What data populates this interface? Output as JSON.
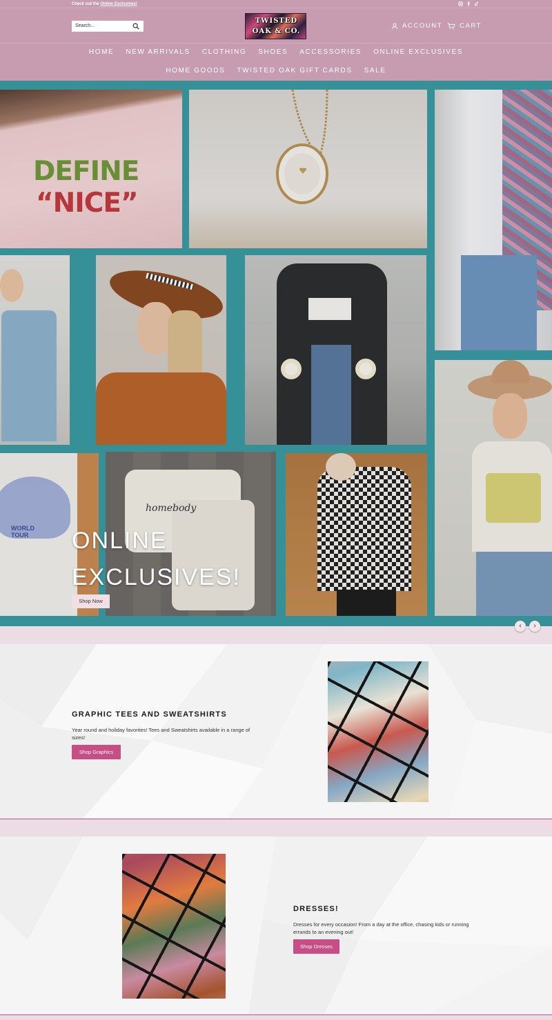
{
  "announcement": {
    "prefix": "Check out the ",
    "link": "Online Exclusives!"
  },
  "social": [
    "instagram-icon",
    "facebook-icon",
    "tiktok-icon"
  ],
  "search": {
    "placeholder": "Search..."
  },
  "logo": {
    "line1": "TWISTED",
    "line2": "OAK & CO."
  },
  "account": {
    "label": "ACCOUNT"
  },
  "cart": {
    "label": "CART"
  },
  "nav": {
    "row1": [
      "HOME",
      "NEW ARRIVALS",
      "CLOTHING",
      "SHOES",
      "ACCESSORIES",
      "ONLINE EXCLUSIVES"
    ],
    "row2": [
      "HOME GOODS",
      "TWISTED OAK GIFT CARDS",
      "SALE"
    ]
  },
  "hero": {
    "title_line1": "ONLINE",
    "title_line2": "EXCLUSIVES!",
    "button": "Shop Now",
    "tile_texts": {
      "sweatshirt": "DEFINE",
      "sweatshirt2": "“NICE”",
      "homebody": "homebody",
      "tee1": "WORLD TOUR"
    }
  },
  "slider": {
    "prev": "‹",
    "next": "›"
  },
  "graphic_section": {
    "title": "GRAPHIC TEES AND SWEATSHIRTS",
    "text": "Year round and holiday favorites! Tees and Sweatshirts available in a range of sizes!",
    "button": "Shop Graphics"
  },
  "dresses_section": {
    "title": "DRESSES!",
    "text": "Dresses for every occasion! From a day at the office, chasing kids or running errands to an evening out!",
    "button": "Shop Dresses"
  },
  "colors": {
    "header": "#c79bb0",
    "hero_bg": "#3a9aa2",
    "accent_button": "#c74d85",
    "band": "#ecdde4"
  }
}
